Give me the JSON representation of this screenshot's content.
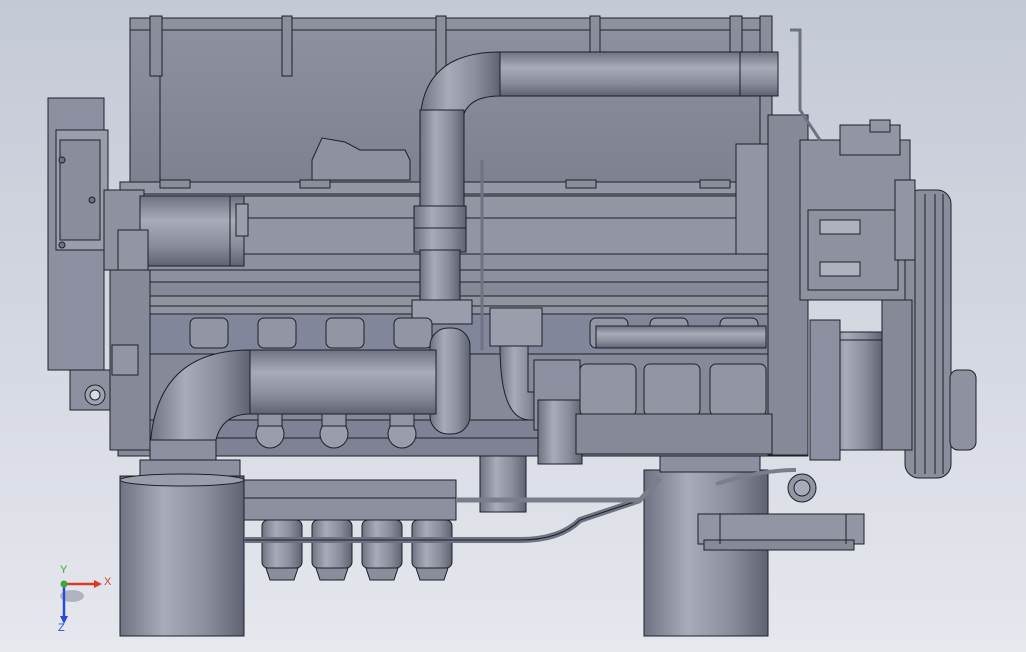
{
  "viewport": {
    "background_top": "#c4c9d6",
    "background_bottom": "#e6e8ee",
    "model_fill": "#8a8e9c",
    "model_fill_light": "#a4a8b6",
    "model_fill_dark": "#6e7282",
    "edge_color": "#1e2028"
  },
  "triad": {
    "x_label": "X",
    "y_label": "Y",
    "z_label": "Z",
    "x_color": "#d83a2a",
    "y_color": "#3aa83a",
    "z_color": "#2a4ad8"
  }
}
